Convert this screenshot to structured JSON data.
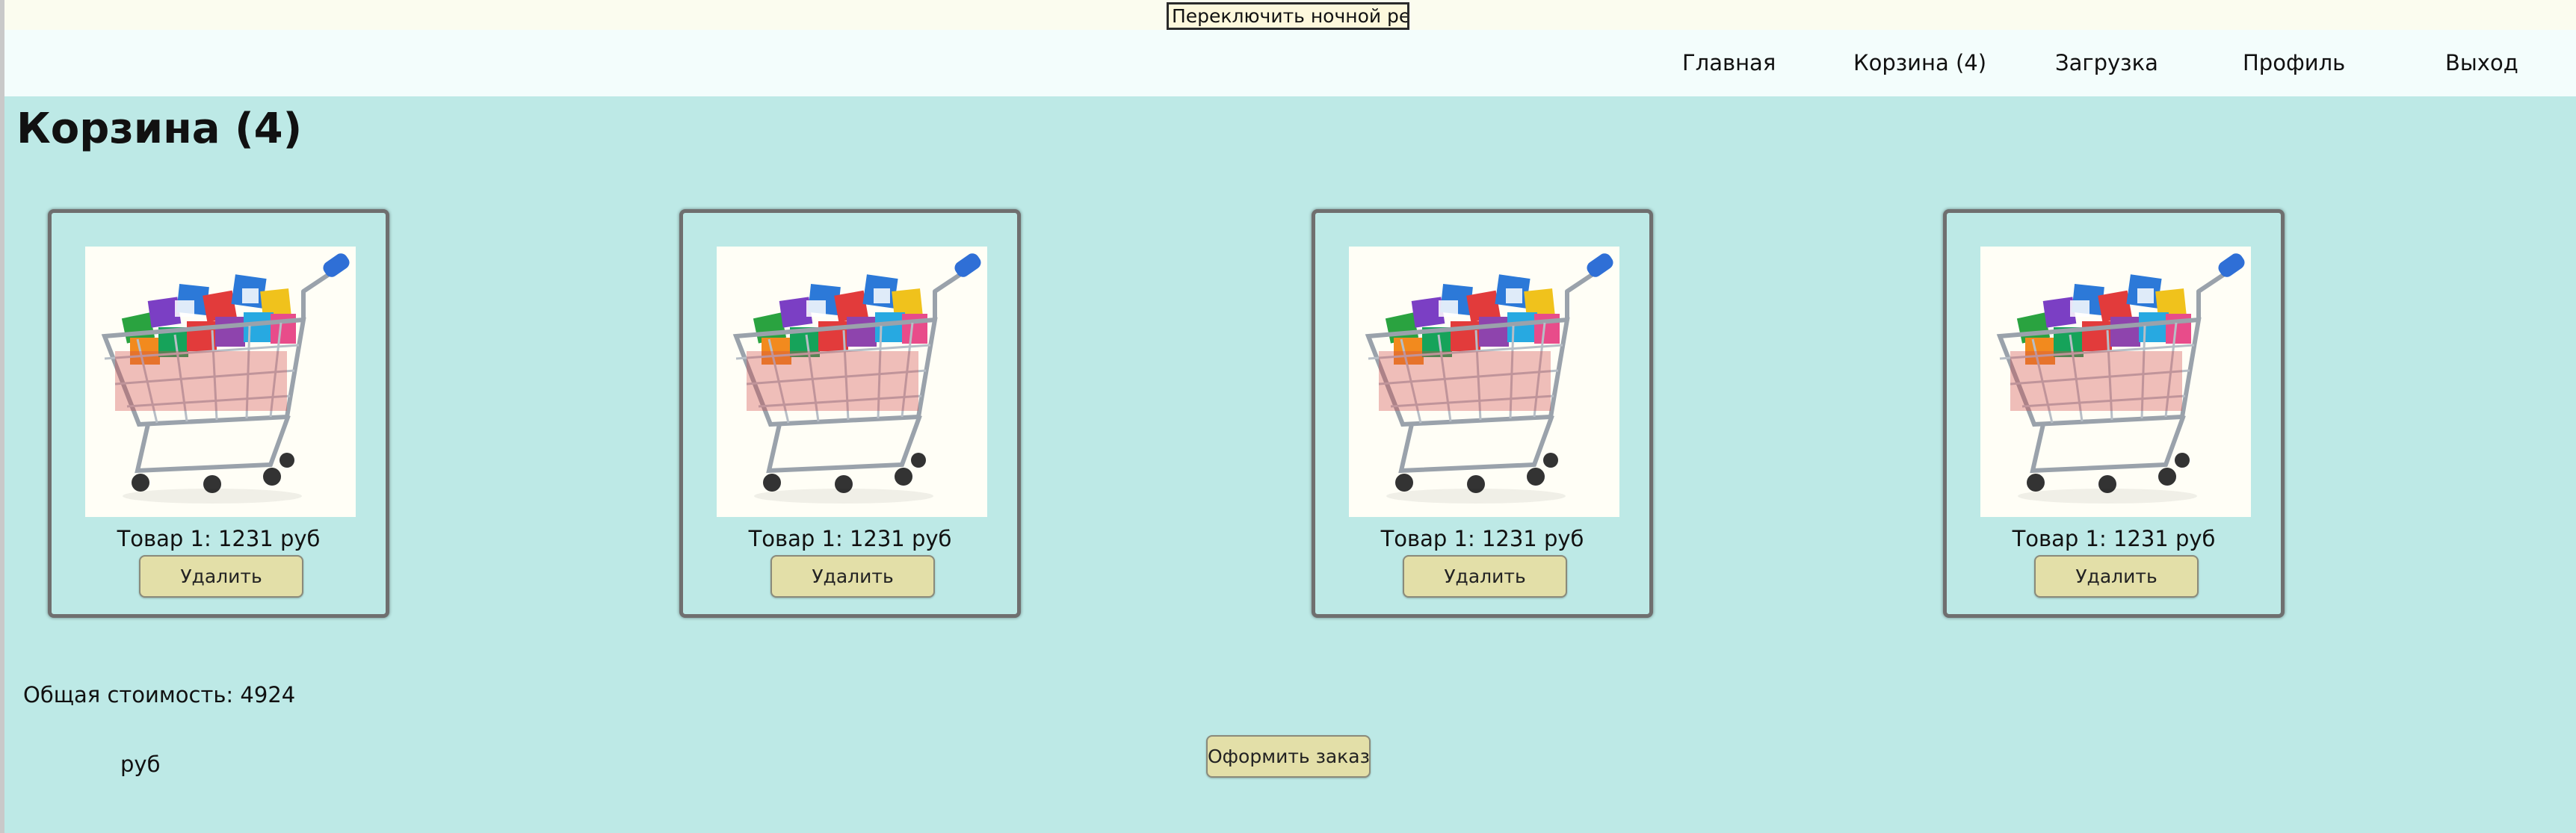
{
  "night_mode_button": "Переключить ночной режим",
  "nav": {
    "items": [
      {
        "label": "Главная"
      },
      {
        "label": "Корзина (4)"
      },
      {
        "label": "Загрузка"
      },
      {
        "label": "Профиль"
      },
      {
        "label": "Выход"
      }
    ]
  },
  "page": {
    "title": "Корзина (4)"
  },
  "cart": {
    "items": [
      {
        "image": "shopping-cart-image",
        "text": "Товар 1: 1231 руб",
        "remove_label": "Удалить"
      },
      {
        "image": "shopping-cart-image",
        "text": "Товар 1: 1231 руб",
        "remove_label": "Удалить"
      },
      {
        "image": "shopping-cart-image",
        "text": "Товар 1: 1231 руб",
        "remove_label": "Удалить"
      },
      {
        "image": "shopping-cart-image",
        "text": "Товар 1: 1231 руб",
        "remove_label": "Удалить"
      }
    ],
    "total_label": "Общая стоимость: 4924",
    "total_unit": "руб",
    "order_label": "Оформить заказ"
  },
  "colors": {
    "page_background": "#bde9e6",
    "navbar_background": "#f3fdfc",
    "button_background": "#e3dfa8",
    "card_border": "#6f6f6f"
  }
}
